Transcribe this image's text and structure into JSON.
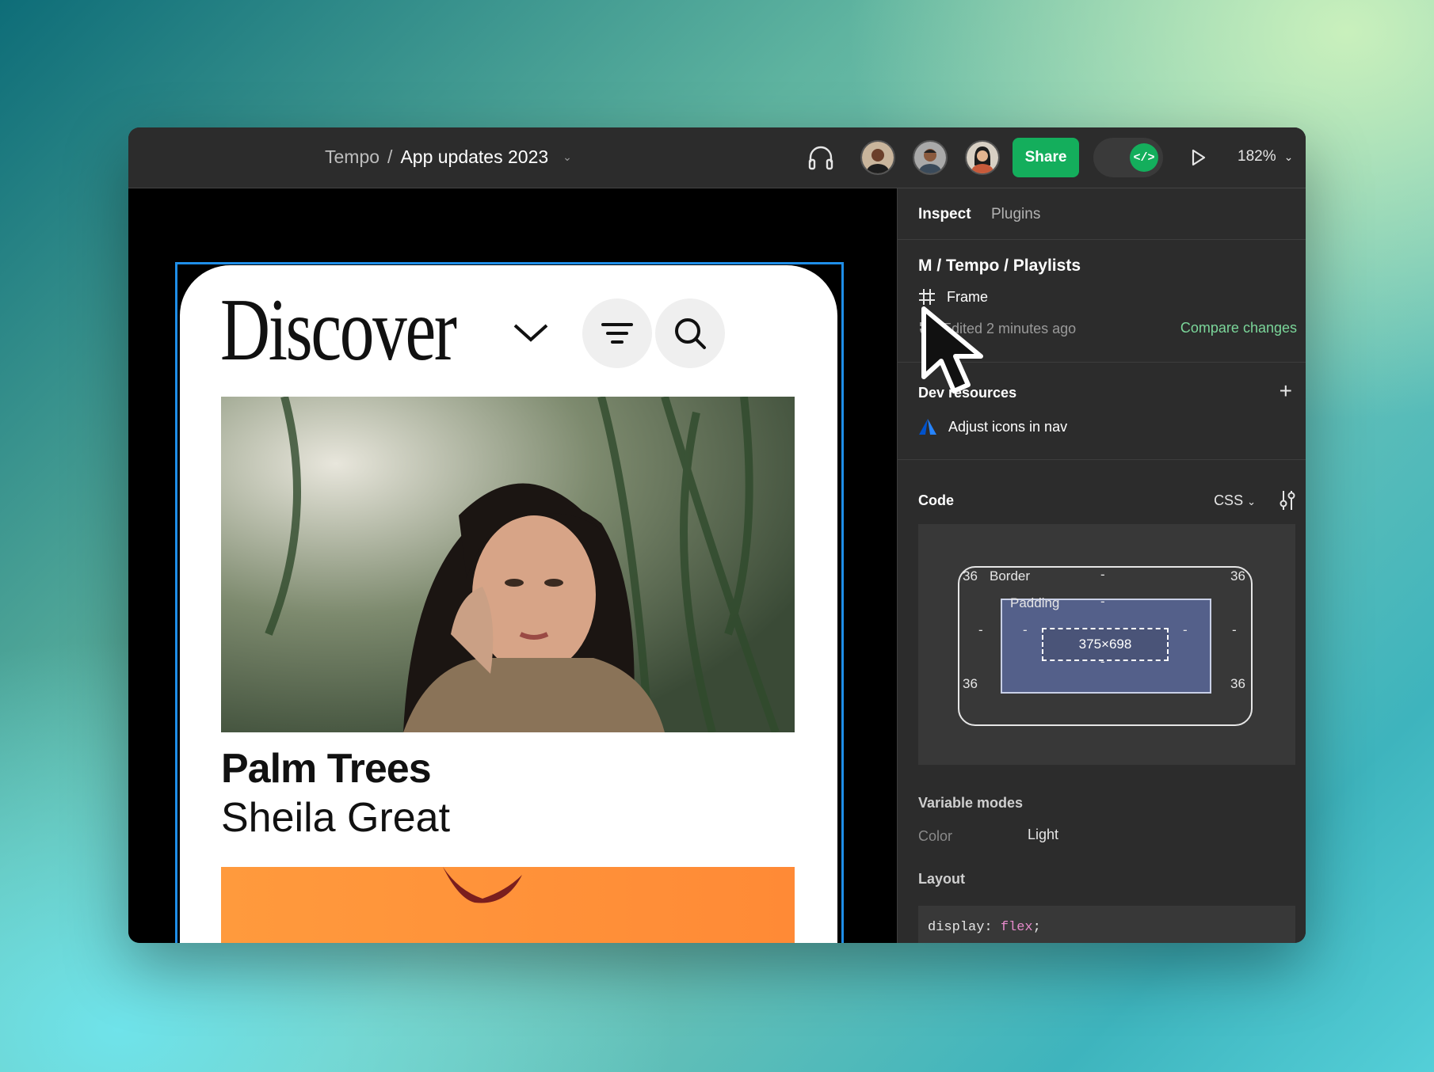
{
  "topbar": {
    "project": "Tempo",
    "separator": "/",
    "file_name": "App updates 2023",
    "share_label": "Share",
    "zoom": "182%",
    "dev_mode_icon": "</>"
  },
  "canvas": {
    "heading": "Discover",
    "track_title": "Palm Trees",
    "track_artist": "Sheila Great"
  },
  "panel": {
    "tabs": [
      {
        "label": "Inspect",
        "active": true
      },
      {
        "label": "Plugins",
        "active": false
      }
    ],
    "selection_path": "M / Tempo / Playlists",
    "layer_type": "Frame",
    "edited": "Edited 2 minutes ago",
    "compare_link": "Compare changes",
    "dev_resources_title": "Dev resources",
    "dev_resource_item": "Adjust icons in nav",
    "code_title": "Code",
    "code_language": "CSS",
    "box_model": {
      "border_label": "Border",
      "padding_label": "Padding",
      "dimensions": "375×698",
      "radius_tl": "36",
      "radius_tr": "36",
      "radius_bl": "36",
      "radius_br": "36",
      "empty": "-"
    },
    "variable_modes_title": "Variable modes",
    "vm_key": "Color",
    "vm_value": "Light",
    "layout_title": "Layout",
    "code_prop": "display: ",
    "code_value": "flex",
    "code_semicolon": ";"
  },
  "colors": {
    "accent_green": "#14ae5c",
    "selection_blue": "#1f8ee8",
    "link_green": "#7bd69a"
  }
}
